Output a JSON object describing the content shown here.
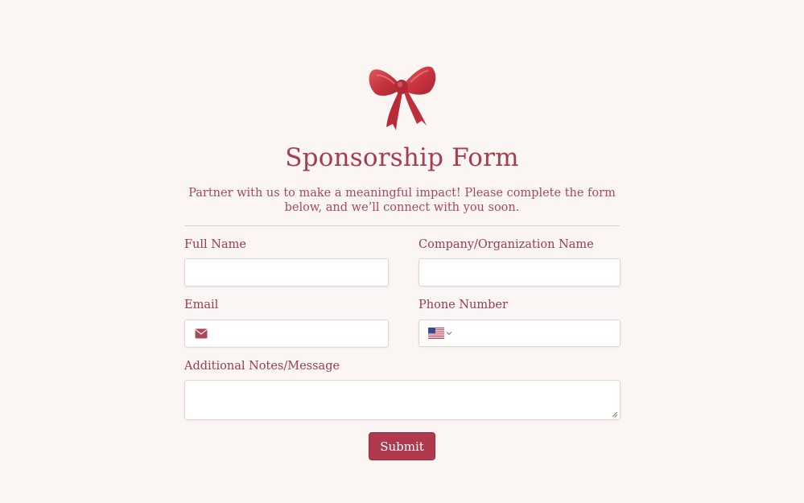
{
  "form": {
    "logo_icon": "red-bow-icon",
    "title": "Sponsorship Form",
    "subtitle": "Partner with us to make a meaningful impact! Please complete the form below, and we’ll connect with you soon.",
    "fields": {
      "full_name": {
        "label": "Full Name",
        "value": ""
      },
      "company": {
        "label": "Company/Organization Name",
        "value": ""
      },
      "email": {
        "label": "Email",
        "value": "",
        "icon": "envelope-icon"
      },
      "phone": {
        "label": "Phone Number",
        "value": "",
        "country_icon": "us-flag-icon"
      },
      "notes": {
        "label": "Additional Notes/Message",
        "value": ""
      }
    },
    "submit_label": "Submit"
  },
  "colors": {
    "background": "#fbf6f3",
    "accent": "#b0394d",
    "text": "#9b3b4a",
    "border": "#e3d3d3"
  }
}
